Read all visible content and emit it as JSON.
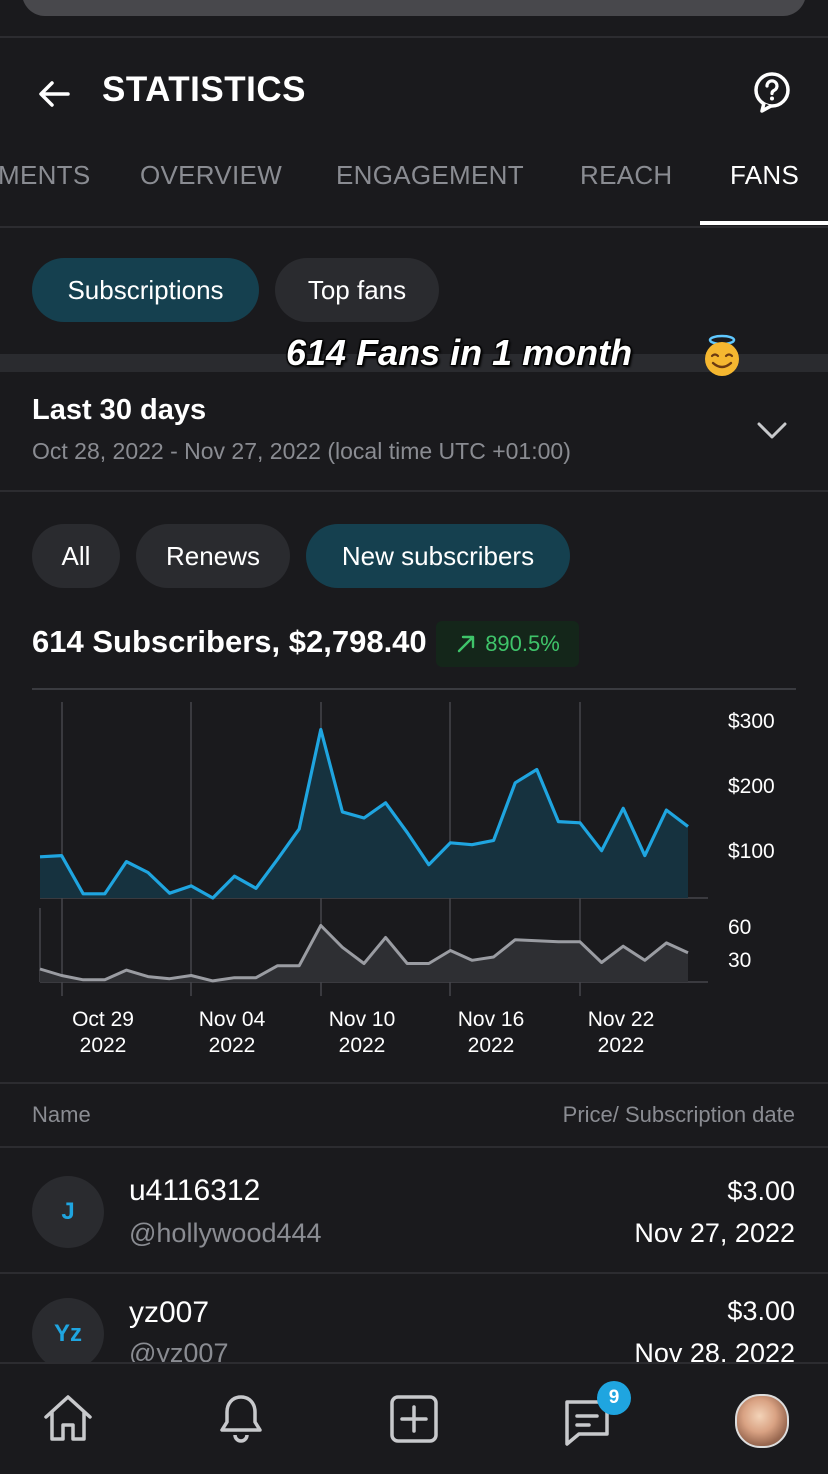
{
  "header": {
    "title": "STATISTICS"
  },
  "tabs": [
    "MENTS",
    "OVERVIEW",
    "ENGAGEMENT",
    "REACH",
    "FANS"
  ],
  "subtabs": {
    "subscriptions": "Subscriptions",
    "top_fans": "Top fans"
  },
  "overlay_caption": "614 Fans in 1 month",
  "period": {
    "label": "Last 30 days",
    "range": "Oct 28, 2022 - Nov 27, 2022 (local time UTC +01:00)"
  },
  "filters": {
    "all": "All",
    "renews": "Renews",
    "new": "New subscribers"
  },
  "summary": {
    "text": "614 Subscribers, $2,798.40",
    "change": "890.5%",
    "change_color": "#3fc46a"
  },
  "chart_data": {
    "type": "area",
    "accent": "#1fa5e0",
    "x_labels": [
      "Oct 29\n2022",
      "Nov 04\n2022",
      "Nov 10\n2022",
      "Nov 16\n2022",
      "Nov 22\n2022"
    ],
    "earnings_axis": [
      "$300",
      "$200",
      "$100"
    ],
    "earnings_ylim": [
      0,
      320
    ],
    "earnings": [
      68,
      70,
      7,
      7,
      60,
      42,
      8,
      20,
      0,
      36,
      16,
      64,
      114,
      278,
      142,
      132,
      157,
      108,
      55,
      91,
      88,
      95,
      190,
      212,
      126,
      124,
      78,
      148,
      70,
      145,
      118
    ],
    "subscribers_axis": [
      "60",
      "30"
    ],
    "subscribers_ylim": [
      0,
      70
    ],
    "subscribers": [
      12,
      6,
      2,
      2,
      11,
      5,
      3,
      6,
      1,
      4,
      4,
      15,
      15,
      52,
      32,
      17,
      41,
      17,
      17,
      29,
      20,
      23,
      39,
      38,
      37,
      37,
      18,
      33,
      20,
      36,
      27
    ]
  },
  "table": {
    "col_name": "Name",
    "col_price": "Price/ Subscription date",
    "rows": [
      {
        "initials": "J",
        "name": "u4116312",
        "handle": "@hollywood444",
        "price": "$3.00",
        "date": "Nov 27, 2022"
      },
      {
        "initials": "Yz",
        "name": "yz007",
        "handle": "@yz007",
        "price": "$3.00",
        "date": "Nov 28, 2022"
      }
    ]
  },
  "nav": {
    "messages_badge": "9"
  }
}
